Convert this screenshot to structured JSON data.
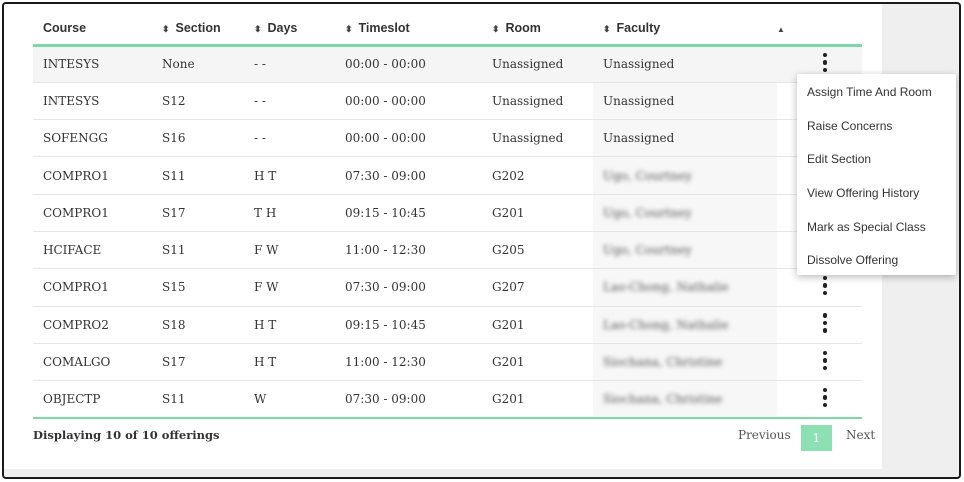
{
  "table": {
    "columns": [
      "Course",
      "Section",
      "Days",
      "Timeslot",
      "Room",
      "Faculty"
    ],
    "rows": [
      {
        "course": "INTESYS",
        "section": "None",
        "days": "- -",
        "timeslot": "00:00 - 00:00",
        "room": "Unassigned",
        "faculty": "Unassigned"
      },
      {
        "course": "INTESYS",
        "section": "S12",
        "days": "- -",
        "timeslot": "00:00 - 00:00",
        "room": "Unassigned",
        "faculty": "Unassigned"
      },
      {
        "course": "SOFENGG",
        "section": "S16",
        "days": "- -",
        "timeslot": "00:00 - 00:00",
        "room": "Unassigned",
        "faculty": "Unassigned"
      },
      {
        "course": "COMPRO1",
        "section": "S11",
        "days": "H T",
        "timeslot": "07:30 - 09:00",
        "room": "G202",
        "faculty": "Ugo, Courtney"
      },
      {
        "course": "COMPRO1",
        "section": "S17",
        "days": "T H",
        "timeslot": "09:15 - 10:45",
        "room": "G201",
        "faculty": "Ugo, Courtney"
      },
      {
        "course": "HCIFACE",
        "section": "S11",
        "days": "F W",
        "timeslot": "11:00 - 12:30",
        "room": "G205",
        "faculty": "Ugo, Courtney"
      },
      {
        "course": "COMPRO1",
        "section": "S15",
        "days": "F W",
        "timeslot": "07:30 - 09:00",
        "room": "G207",
        "faculty": "Lao-Chong, Nathalie"
      },
      {
        "course": "COMPRO2",
        "section": "S18",
        "days": "H T",
        "timeslot": "09:15 - 10:45",
        "room": "G201",
        "faculty": "Lao-Chong, Nathalie"
      },
      {
        "course": "COMALGO",
        "section": "S17",
        "days": "H T",
        "timeslot": "11:00 - 12:30",
        "room": "G201",
        "faculty": "Siochana, Christine"
      },
      {
        "course": "OBJECTP",
        "section": "S11",
        "days": "W",
        "timeslot": "07:30 - 09:00",
        "room": "G201",
        "faculty": "Siochana, Christine"
      }
    ]
  },
  "context_menu": {
    "items": [
      "Assign Time And Room",
      "Raise Concerns",
      "Edit Section",
      "View Offering History",
      "Mark as Special Class",
      "Dissolve Offering"
    ]
  },
  "footer": {
    "status": "Displaying 10 of 10 offerings",
    "previous": "Previous",
    "page": "1",
    "next": "Next"
  },
  "icons": {
    "sort": "sort-arrows-icon",
    "sort_active": "sort-up-icon",
    "row_actions": "kebab-menu-icon"
  },
  "colors": {
    "accent": "#7dd8a8",
    "active_page": "#8de0b4"
  }
}
